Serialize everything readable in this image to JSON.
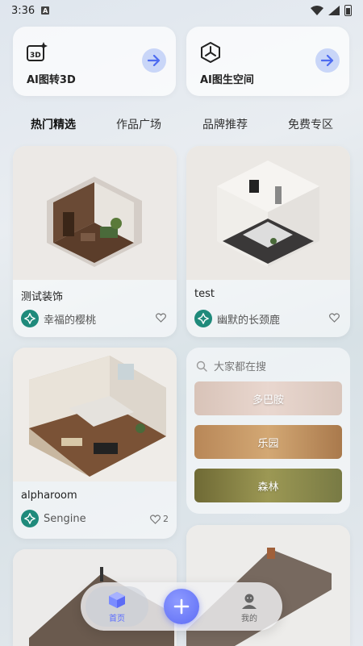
{
  "status_bar": {
    "time": "3:36",
    "sim_label": "A"
  },
  "features": [
    {
      "label": "AI图转3D",
      "icon": "3d-cube-icon"
    },
    {
      "label": "AI图生空间",
      "icon": "space-cube-icon"
    }
  ],
  "tabs": [
    {
      "label": "热门精选",
      "active": true
    },
    {
      "label": "作品广场",
      "active": false
    },
    {
      "label": "品牌推荐",
      "active": false
    },
    {
      "label": "免费专区",
      "active": false
    }
  ],
  "cards": [
    {
      "title": "测试装饰",
      "author": "幸福的樱桃",
      "likes": ""
    },
    {
      "title": "test",
      "author": "幽默的长颈鹿",
      "likes": ""
    },
    {
      "title": "alpharoom",
      "author": "Sengine",
      "likes": "2"
    }
  ],
  "search": {
    "placeholder": "大家都在搜",
    "chips": [
      {
        "label": "多巴胺"
      },
      {
        "label": "乐园"
      },
      {
        "label": "森林"
      }
    ]
  },
  "bottom_nav": {
    "home_label": "首页",
    "me_label": "我的"
  },
  "colors": {
    "accent": "#5d6cf5",
    "avatar": "#1f8a7b",
    "arrow_bg": "#c9d6f8"
  }
}
